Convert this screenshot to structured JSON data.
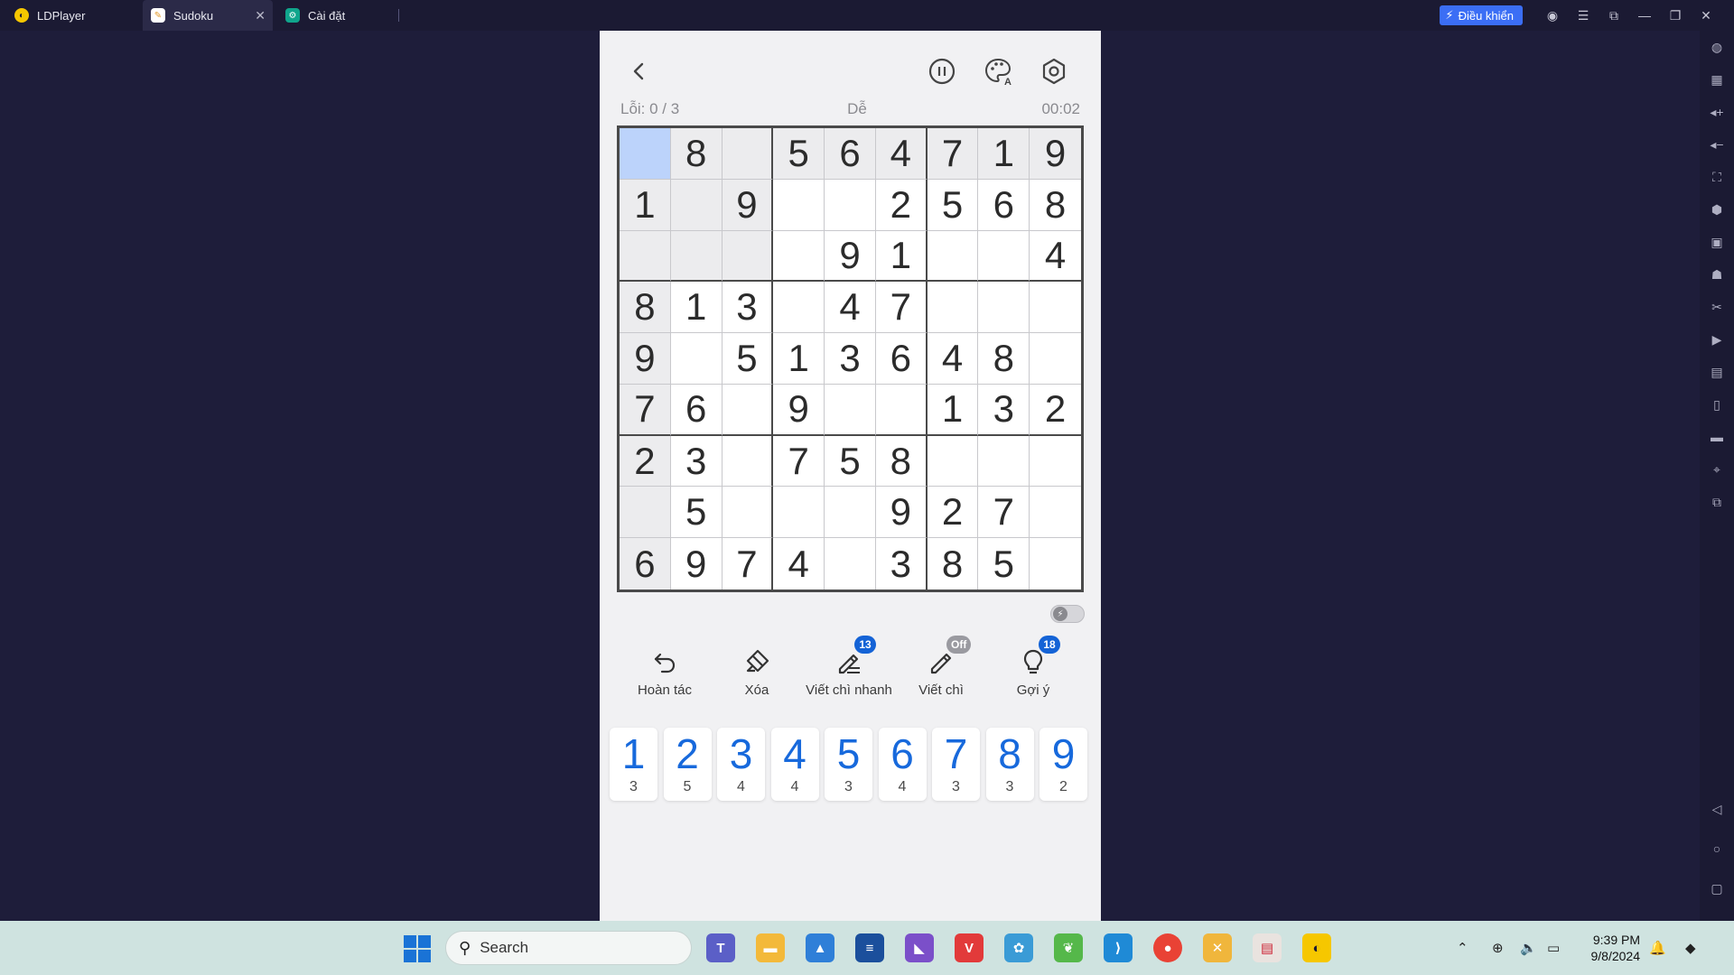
{
  "window": {
    "tabs": [
      {
        "label": "LDPlayer",
        "icon": "ldplayer-icon"
      },
      {
        "label": "Sudoku",
        "icon": "sudoku-app-icon"
      },
      {
        "label": "Cài đặt",
        "icon": "settings-app-icon"
      }
    ],
    "control_button": "Điều khiển",
    "accent": "#3b6ef5"
  },
  "game": {
    "errors": "Lỗi: 0 / 3",
    "difficulty": "Dễ",
    "timer": "00:02",
    "selected_cell": [
      0,
      0
    ],
    "board": [
      [
        "",
        "8",
        "",
        "5",
        "6",
        "4",
        "7",
        "1",
        "9"
      ],
      [
        "1",
        "",
        "9",
        "",
        "",
        "2",
        "5",
        "6",
        "8"
      ],
      [
        "",
        "",
        "",
        "",
        "9",
        "1",
        "",
        "",
        "4"
      ],
      [
        "8",
        "1",
        "3",
        "",
        "4",
        "7",
        "",
        "",
        ""
      ],
      [
        "9",
        "",
        "5",
        "1",
        "3",
        "6",
        "4",
        "8",
        ""
      ],
      [
        "7",
        "6",
        "",
        "9",
        "",
        "",
        "1",
        "3",
        "2"
      ],
      [
        "2",
        "3",
        "",
        "7",
        "5",
        "8",
        "",
        "",
        ""
      ],
      [
        "",
        "5",
        "",
        "",
        "",
        "9",
        "2",
        "7",
        ""
      ],
      [
        "6",
        "9",
        "7",
        "4",
        "",
        "3",
        "8",
        "5",
        ""
      ]
    ],
    "tools": [
      {
        "label": "Hoàn tác",
        "icon": "undo-icon",
        "badge": ""
      },
      {
        "label": "Xóa",
        "icon": "eraser-icon",
        "badge": ""
      },
      {
        "label": "Viết chì nhanh",
        "icon": "quick-pencil-icon",
        "badge": "13"
      },
      {
        "label": "Viết chì",
        "icon": "pencil-icon",
        "badge": "Off"
      },
      {
        "label": "Gợi ý",
        "icon": "lightbulb-icon",
        "badge": "18"
      }
    ],
    "numpad": [
      {
        "digit": "1",
        "remaining": "3"
      },
      {
        "digit": "2",
        "remaining": "5"
      },
      {
        "digit": "3",
        "remaining": "4"
      },
      {
        "digit": "4",
        "remaining": "4"
      },
      {
        "digit": "5",
        "remaining": "3"
      },
      {
        "digit": "6",
        "remaining": "4"
      },
      {
        "digit": "7",
        "remaining": "3"
      },
      {
        "digit": "8",
        "remaining": "3"
      },
      {
        "digit": "9",
        "remaining": "2"
      }
    ],
    "colors": {
      "number": "#1769dc",
      "selected": "#bcd3fb",
      "highlight": "#ececee"
    }
  },
  "taskbar": {
    "search_placeholder": "Search",
    "time": "9:39 PM",
    "date": "9/8/2024"
  }
}
